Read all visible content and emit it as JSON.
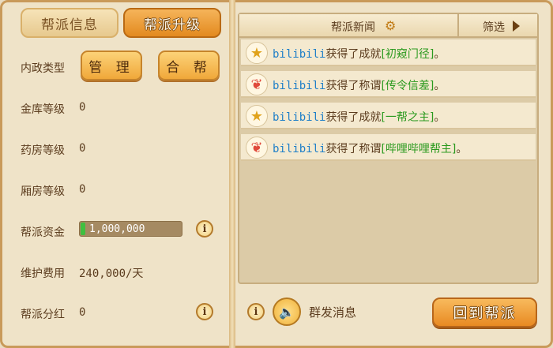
{
  "tabs": {
    "info": "帮派信息",
    "upgrade": "帮派升级"
  },
  "left": {
    "internal_label": "内政类型",
    "btn_manage": "管 理",
    "btn_merge": "合 帮",
    "vault_label": "金库等级",
    "vault_val": "0",
    "pharmacy_label": "药房等级",
    "pharmacy_val": "0",
    "wing_label": "厢房等级",
    "wing_val": "0",
    "funds_label": "帮派资金",
    "funds_val": "1,000,000",
    "funds_fill_fraction": 0.05,
    "upkeep_label": "维护费用",
    "upkeep_val": "240,000/天",
    "dividend_label": "帮派分红",
    "dividend_val": "0",
    "info_glyph": "i"
  },
  "news": {
    "title": "帮派新闻",
    "filter": "筛选",
    "items": [
      {
        "icon": "star-badge-icon",
        "who": "bilibili",
        "verb": "获得了成就",
        "hl": "[初窥门径]",
        "end": "。"
      },
      {
        "icon": "wing-badge-icon",
        "who": "bilibili",
        "verb": "获得了称谓",
        "hl": "[传令信差]",
        "end": "。"
      },
      {
        "icon": "star-badge-icon",
        "who": "bilibili",
        "verb": "获得了成就",
        "hl": "[一帮之主]",
        "end": "。"
      },
      {
        "icon": "wing-badge-icon",
        "who": "bilibili",
        "verb": "获得了称谓",
        "hl": "[哔哩哔哩帮主]",
        "end": "。"
      }
    ]
  },
  "bottom": {
    "group_msg": "群发消息",
    "return_btn": "回到帮派",
    "info_glyph": "i"
  }
}
